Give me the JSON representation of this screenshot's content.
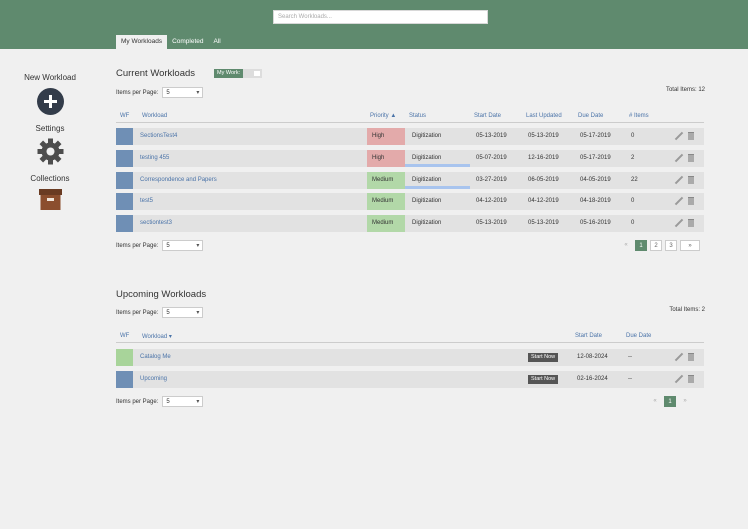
{
  "header": {
    "search_placeholder": "Search Workloads...",
    "tabs": [
      {
        "label": "My Workloads"
      },
      {
        "label": "Completed"
      },
      {
        "label": "All"
      }
    ]
  },
  "sidebar": {
    "new_workload": "New Workload",
    "settings": "Settings",
    "collections": "Collections"
  },
  "current": {
    "title": "Current Workloads",
    "my_work_label": "My Work:",
    "items_per_page_label": "Items per Page:",
    "items_per_page_value": "5",
    "total_label": "Total Items: 12",
    "columns": {
      "wf": "WF",
      "workload": "Workload",
      "priority": "Priority ▲",
      "status": "Status",
      "start": "Start Date",
      "updated": "Last Updated",
      "due": "Due Date",
      "items": "# Items"
    },
    "rows": [
      {
        "workload": "SectionsTest4",
        "priority": "High",
        "status": "Digitization",
        "start": "05-13-2019",
        "updated": "05-13-2019",
        "due": "05-17-2019",
        "items": "0"
      },
      {
        "workload": "testing 455",
        "priority": "High",
        "status": "Digitization",
        "start": "05-07-2019",
        "updated": "12-16-2019",
        "due": "05-17-2019",
        "items": "2"
      },
      {
        "workload": "Correspondence and Papers",
        "priority": "Medium",
        "status": "Digitization",
        "start": "03-27-2019",
        "updated": "06-05-2019",
        "due": "04-05-2019",
        "items": "22"
      },
      {
        "workload": "test5",
        "priority": "Medium",
        "status": "Digitization",
        "start": "04-12-2019",
        "updated": "04-12-2019",
        "due": "04-18-2019",
        "items": "0"
      },
      {
        "workload": "sectiontest3",
        "priority": "Medium",
        "status": "Digitization",
        "start": "05-13-2019",
        "updated": "05-13-2019",
        "due": "05-16-2019",
        "items": "0"
      }
    ],
    "pager": {
      "prev": "«",
      "pages": [
        "1",
        "2",
        "3"
      ],
      "next": "»"
    }
  },
  "upcoming": {
    "title": "Upcoming Workloads",
    "items_per_page_label": "Items per Page:",
    "items_per_page_value": "5",
    "total_label": "Total Items: 2",
    "columns": {
      "wf": "WF",
      "workload": "Workload ▾",
      "start": "Start Date",
      "due": "Due Date"
    },
    "start_now_label": "Start Now",
    "rows": [
      {
        "workload": "Catalog Me",
        "start": "12-08-2024",
        "due": "--"
      },
      {
        "workload": "Upcoming",
        "start": "02-16-2024",
        "due": "--"
      }
    ],
    "pager": {
      "prev": "«",
      "pages": [
        "1"
      ],
      "next": "»"
    }
  },
  "colors": {
    "header": "#5f8a6e",
    "high": "#e3aaaa",
    "medium": "#b2d8a8",
    "wf_blue": "#6f8fb5",
    "wf_green": "#a8d49a",
    "link": "#4a73a8"
  }
}
